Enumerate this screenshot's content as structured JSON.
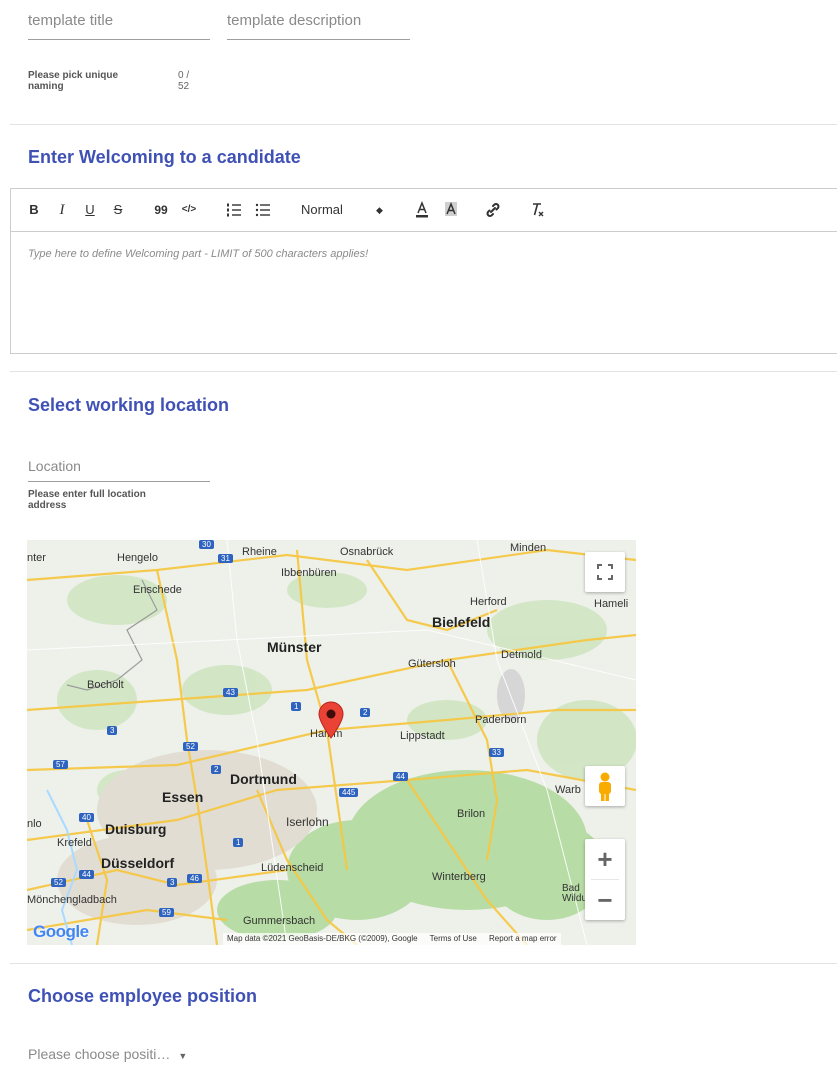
{
  "template": {
    "title_placeholder": "template title",
    "description_placeholder": "template description",
    "hint": "Please pick unique naming",
    "counter": "0 / 52"
  },
  "welcome": {
    "heading": "Enter Welcoming to a candidate",
    "format_select": "Normal",
    "placeholder": "Type here to define Welcoming part - LIMIT of 500 characters applies!",
    "toolbar_glyphs": {
      "bold": "B",
      "italic": "I",
      "underline": "U",
      "strike": "S",
      "quote": "99",
      "code": "</>"
    }
  },
  "location": {
    "heading": "Select working location",
    "placeholder": "Location",
    "hint": "Please enter full location address"
  },
  "map": {
    "places": {
      "enter": "nter",
      "hengelo": "Hengelo",
      "rheine": "Rheine",
      "osnabruck": "Osnabrück",
      "minden": "Minden",
      "ibbenburen": "Ibbenbüren",
      "enschede": "Enschede",
      "herford": "Herford",
      "hameln": "Hameli",
      "bielefeld": "Bielefeld",
      "munster": "Münster",
      "detmold": "Detmold",
      "gutersloh": "Gütersloh",
      "bocholt": "Bocholt",
      "paderborn": "Paderborn",
      "hamm": "Hamm",
      "lippstadt": "Lippstadt",
      "dortmund": "Dortmund",
      "essen": "Essen",
      "warburg": "Warb",
      "nlo": "nlo",
      "duisburg": "Duisburg",
      "iserlohn": "Iserlohn",
      "brilon": "Brilon",
      "krefeld": "Krefeld",
      "dusseldorf": "Düsseldorf",
      "ludenscheid": "Lüdenscheid",
      "winterberg": "Winterberg",
      "bad_wildungen": "Bad Wildun",
      "monchengladbach": "Mönchengladbach",
      "gummersbach": "Gummersbach"
    },
    "roads": [
      "30",
      "31",
      "1",
      "43",
      "2",
      "3",
      "52",
      "57",
      "2",
      "44",
      "445",
      "33",
      "40",
      "1",
      "44",
      "3",
      "46",
      "59",
      "52"
    ],
    "logo": "Google",
    "attribution": {
      "data": "Map data ©2021 GeoBasis-DE/BKG (©2009), Google",
      "terms": "Terms of Use",
      "report": "Report a map error"
    },
    "zoom_in": "+",
    "zoom_out": "−"
  },
  "position": {
    "heading": "Choose employee position",
    "dropdown_label": "Please choose positi…"
  },
  "colors": {
    "accent": "#3f51b5",
    "pin": "#ea4335",
    "pegman": "#f9ab00"
  }
}
